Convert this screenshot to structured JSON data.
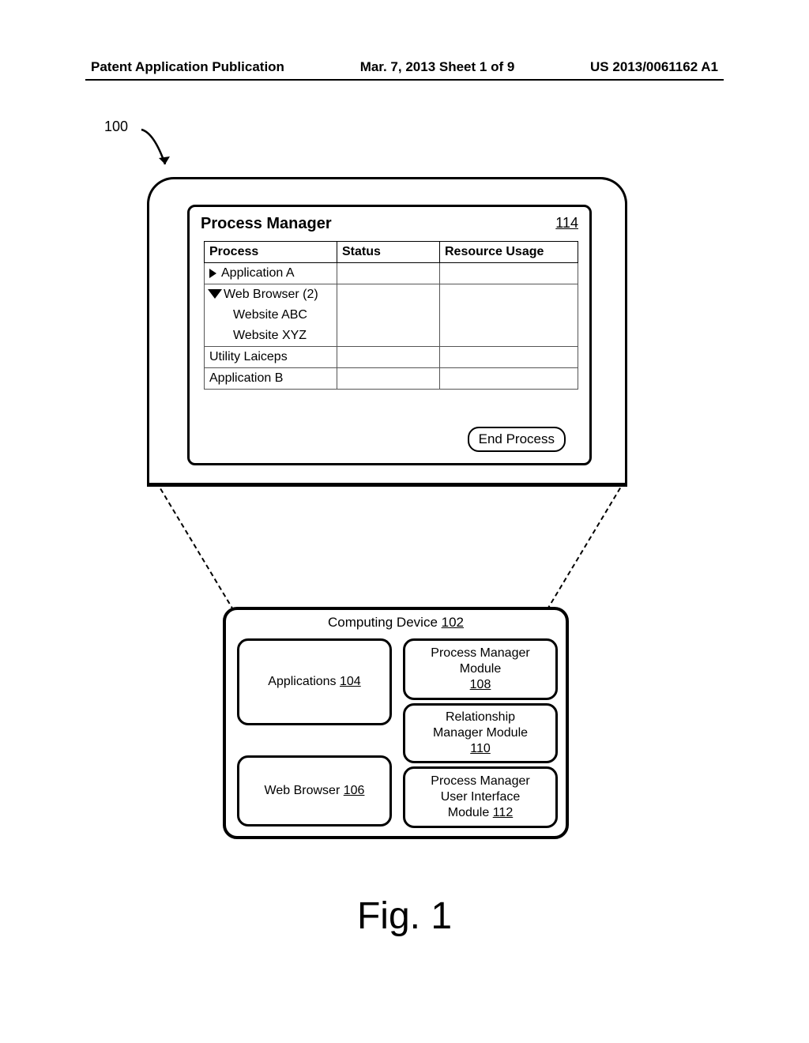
{
  "header": {
    "left": "Patent Application Publication",
    "center": "Mar. 7, 2013  Sheet 1 of 9",
    "right": "US 2013/0061162 A1"
  },
  "ref100": "100",
  "monitor": {
    "window": {
      "title": "Process Manager",
      "ref": "114",
      "columns": {
        "process": "Process",
        "status": "Status",
        "usage": "Resource Usage"
      },
      "rows": {
        "appA": "Application A",
        "webBrowser": "Web Browser (2)",
        "websiteABC": "Website ABC",
        "websiteXYZ": "Website XYZ",
        "utility": "Utility Laiceps",
        "appB": "Application B"
      },
      "end_btn": "End Process"
    }
  },
  "device": {
    "title_pre": "Computing Device ",
    "title_ref": "102",
    "apps_pre": "Applications ",
    "apps_ref": "104",
    "wb_pre": "Web Browser ",
    "wb_ref": "106",
    "pmm_l1": "Process Manager",
    "pmm_l2": "Module",
    "pmm_ref": "108",
    "rmm_l1": "Relationship",
    "rmm_l2": "Manager Module",
    "rmm_ref": "110",
    "pmui_l1": "Process Manager",
    "pmui_l2": "User Interface",
    "pmui_l3_pre": "Module ",
    "pmui_ref": "112"
  },
  "figure_label": "Fig. 1"
}
